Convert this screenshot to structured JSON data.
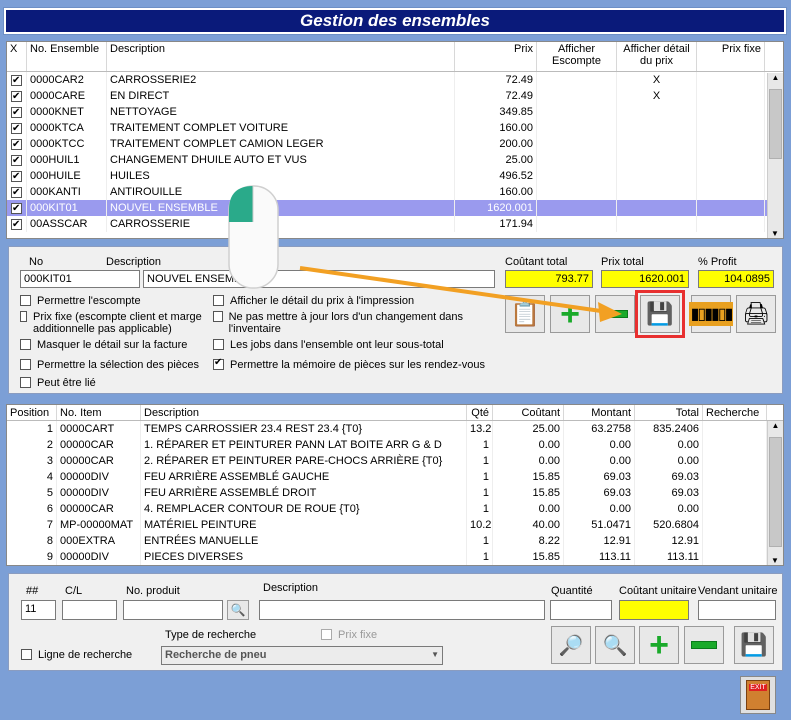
{
  "window": {
    "title": "Gestion des ensembles"
  },
  "ensembles": {
    "headers": {
      "x": "X",
      "no": "No. Ensemble",
      "desc": "Description",
      "prix": "Prix",
      "escompte": "Afficher Escompte",
      "detail": "Afficher détail du prix",
      "fixe": "Prix fixe"
    },
    "rows": [
      {
        "no": "0000CAR2",
        "desc": "CARROSSERIE2",
        "prix": "72.49",
        "detail": "X"
      },
      {
        "no": "0000CARE",
        "desc": "EN DIRECT",
        "prix": "72.49",
        "detail": "X"
      },
      {
        "no": "0000KNET",
        "desc": "NETTOYAGE",
        "prix": "349.85",
        "detail": ""
      },
      {
        "no": "0000KTCA",
        "desc": "TRAITEMENT COMPLET VOITURE",
        "prix": "160.00",
        "detail": ""
      },
      {
        "no": "0000KTCC",
        "desc": "TRAITEMENT COMPLET CAMION LEGER",
        "prix": "200.00",
        "detail": ""
      },
      {
        "no": "000HUIL1",
        "desc": "CHANGEMENT DHUILE AUTO ET VUS",
        "prix": "25.00",
        "detail": ""
      },
      {
        "no": "000HUILE",
        "desc": "HUILES",
        "prix": "496.52",
        "detail": ""
      },
      {
        "no": "000KANTI",
        "desc": "ANTIROUILLE",
        "prix": "160.00",
        "detail": ""
      },
      {
        "no": "000KIT01",
        "desc": "NOUVEL ENSEMBLE",
        "prix": "1620.001",
        "detail": ""
      },
      {
        "no": "00ASSCAR",
        "desc": "CARROSSERIE",
        "prix": "171.94",
        "detail": ""
      }
    ]
  },
  "detail": {
    "no_label": "No",
    "desc_label": "Description",
    "no_value": "000KIT01",
    "desc_value": "NOUVEL ENSEMBLE",
    "cout_label": "Coûtant total",
    "cout_value": "793.77",
    "prix_label": "Prix total",
    "prix_value": "1620.001",
    "profit_label": "% Profit",
    "profit_value": "104.0895",
    "options": [
      {
        "label": "Permettre l'escompte",
        "checked": false
      },
      {
        "label": "Prix fixe (escompte client et marge additionnelle  pas applicable)",
        "checked": false
      },
      {
        "label": "Masquer le détail sur la facture",
        "checked": false
      },
      {
        "label": "Permettre la sélection des pièces",
        "checked": false
      },
      {
        "label": "Peut être lié",
        "checked": false
      },
      {
        "label": "Afficher le détail du prix à l'impression",
        "checked": false
      },
      {
        "label": "Ne pas mettre à jour lors d'un changement dans l'inventaire",
        "checked": false
      },
      {
        "label": "Les jobs dans l'ensemble ont leur sous-total",
        "checked": false
      },
      {
        "label": "Permettre la mémoire de pièces sur les rendez-vous",
        "checked": true
      }
    ]
  },
  "items": {
    "headers": {
      "pos": "Position",
      "no": "No. Item",
      "desc": "Description",
      "qte": "Qté",
      "cout": "Coûtant",
      "montant": "Montant",
      "total": "Total",
      "rech": "Recherche"
    },
    "rows": [
      {
        "pos": "1",
        "no": "0000CART",
        "desc": "TEMPS CARROSSIER 23.4  REST 23.4   {T0}",
        "qte": "13.2",
        "cout": "25.00",
        "montant": "63.2758",
        "total": "835.2406"
      },
      {
        "pos": "2",
        "no": "00000CAR",
        "desc": "1. RÉPARER ET PEINTURER PANN LAT BOITE ARR G & D",
        "qte": "1",
        "cout": "0.00",
        "montant": "0.00",
        "total": "0.00"
      },
      {
        "pos": "3",
        "no": "00000CAR",
        "desc": "2. RÉPARER ET PEINTURER PARE-CHOCS ARRIÈRE {T0}",
        "qte": "1",
        "cout": "0.00",
        "montant": "0.00",
        "total": "0.00"
      },
      {
        "pos": "4",
        "no": "00000DIV",
        "desc": "FEU ARRIÈRE ASSEMBLÉ GAUCHE",
        "qte": "1",
        "cout": "15.85",
        "montant": "69.03",
        "total": "69.03"
      },
      {
        "pos": "5",
        "no": "00000DIV",
        "desc": "FEU ARRIÈRE ASSEMBLÉ DROIT",
        "qte": "1",
        "cout": "15.85",
        "montant": "69.03",
        "total": "69.03"
      },
      {
        "pos": "6",
        "no": "00000CAR",
        "desc": "4. REMPLACER CONTOUR DE ROUE {T0}",
        "qte": "1",
        "cout": "0.00",
        "montant": "0.00",
        "total": "0.00"
      },
      {
        "pos": "7",
        "no": "MP-00000MAT",
        "desc": "MATÉRIEL PEINTURE",
        "qte": "10.2",
        "cout": "40.00",
        "montant": "51.0471",
        "total": "520.6804"
      },
      {
        "pos": "8",
        "no": "000EXTRA",
        "desc": "ENTRÉES MANUELLE",
        "qte": "1",
        "cout": "8.22",
        "montant": "12.91",
        "total": "12.91"
      },
      {
        "pos": "9",
        "no": "00000DIV",
        "desc": "PIECES DIVERSES",
        "qte": "1",
        "cout": "15.85",
        "montant": "113.11",
        "total": "113.11"
      }
    ]
  },
  "entry": {
    "num_label": "##",
    "cl_label": "C/L",
    "prod_label": "No. produit",
    "desc_label": "Description",
    "qty_label": "Quantité",
    "cout_label": "Coûtant unitaire",
    "vend_label": "Vendant unitaire",
    "num_value": "11",
    "search_line_label": "Ligne de recherche",
    "type_label": "Type de recherche",
    "type_value": "Recherche de pneu",
    "prix_fixe_label": "Prix fixe"
  },
  "exit_label": "EXIT"
}
